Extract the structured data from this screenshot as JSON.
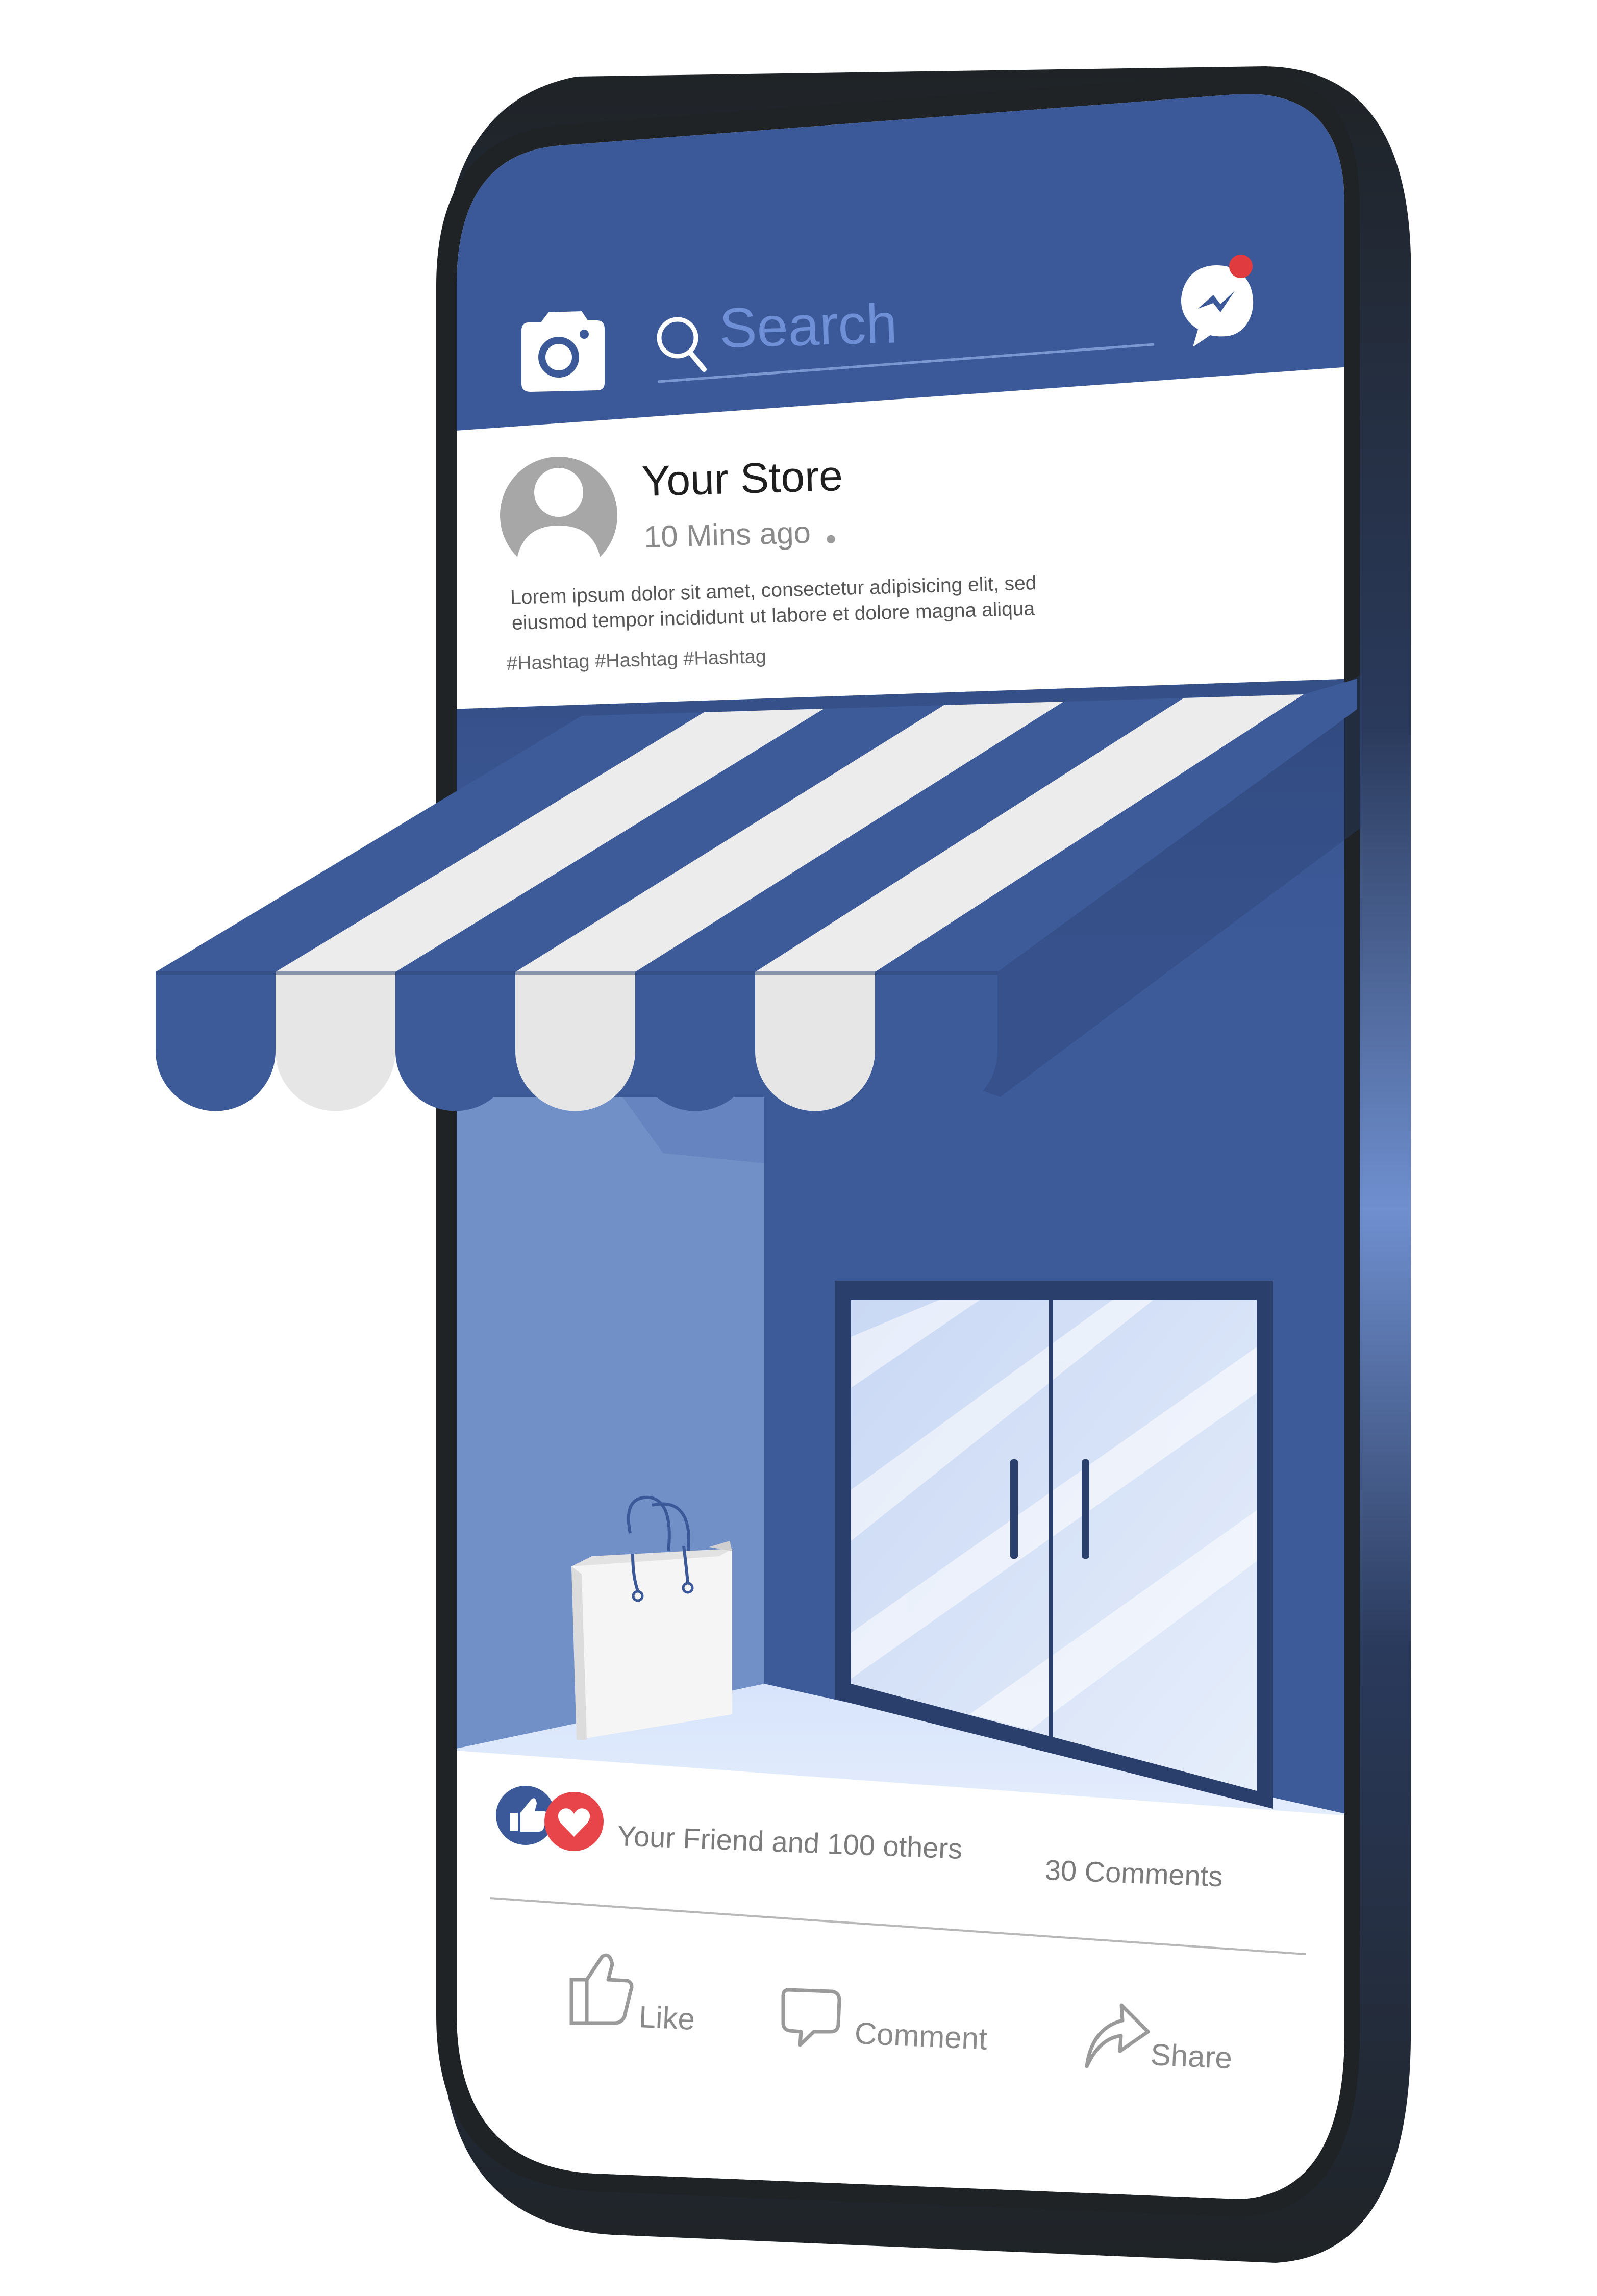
{
  "search": {
    "placeholder": "Search"
  },
  "post": {
    "author": "Your Store",
    "time": "10 Mins ago",
    "time_separator": "•",
    "body_lines": [
      "Lorem ipsum dolor sit amet, consectetur adipisicing elit, sed",
      "eiusmod tempor incididunt ut labore et dolore magna aliqua"
    ],
    "hashtags": "#Hashtag #Hashtag #Hashtag"
  },
  "reactions": {
    "summary": "Your Friend and 100 others",
    "comments": "30 Comments"
  },
  "actions": {
    "like": "Like",
    "comment": "Comment",
    "share": "Share"
  },
  "icons": {
    "camera": "camera-icon",
    "search": "search-icon",
    "messenger": "messenger-icon",
    "avatar": "avatar-icon",
    "like_reaction": "thumbs-up-icon",
    "love_reaction": "heart-icon",
    "like_action": "thumbs-up-outline-icon",
    "comment_action": "speech-bubble-icon",
    "share_action": "share-arrow-icon",
    "shopping_bag": "shopping-bag-icon"
  },
  "colors": {
    "brand_blue": "#3d5a99",
    "header_blue": "#3b5998",
    "light_blue": "#7290c8",
    "notification_red": "#e03b3f",
    "love_red": "#e8454a",
    "frame_black": "#1f2326",
    "stripe_white": "#f2f2f2"
  }
}
